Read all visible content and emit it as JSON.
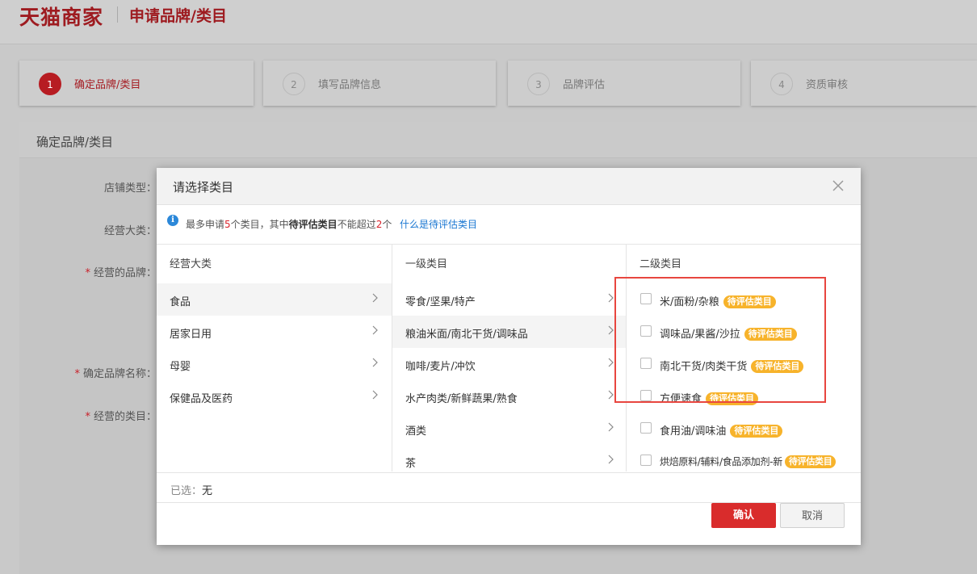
{
  "header": {
    "logo": "天猫商家",
    "title": "申请品牌/类目"
  },
  "steps": [
    {
      "num": "1",
      "label": "确定品牌/类目",
      "active": true
    },
    {
      "num": "2",
      "label": "填写品牌信息",
      "active": false
    },
    {
      "num": "3",
      "label": "品牌评估",
      "active": false
    },
    {
      "num": "4",
      "label": "资质审核",
      "active": false
    }
  ],
  "panel": {
    "title": "确定品牌/类目",
    "fields": {
      "store_type": "店铺类型：",
      "main_category": "经营大类：",
      "brand": "经营的品牌：",
      "brand_name": "确定品牌名称：",
      "category": "经营的类目："
    },
    "required_mark": "*"
  },
  "dialog": {
    "title": "请选择类目",
    "notice": {
      "p1": "最多申请",
      "max": "5",
      "p2": "个类目，其中",
      "bold": "待评估类目",
      "p3": "不能超过",
      "limit": "2",
      "p4": "个",
      "link": "什么是待评估类目"
    },
    "columns": {
      "main": {
        "header": "经营大类",
        "items": [
          "食品",
          "居家日用",
          "母婴",
          "保健品及医药"
        ],
        "selected_index": 0
      },
      "level1": {
        "header": "一级类目",
        "items": [
          "零食/坚果/特产",
          "粮油米面/南北干货/调味品",
          "咖啡/麦片/冲饮",
          "水产肉类/新鲜蔬果/熟食",
          "酒类",
          "茶"
        ],
        "selected_index": 1
      },
      "level2": {
        "header": "二级类目",
        "badge": "待评估类目",
        "items": [
          "米/面粉/杂粮",
          "调味品/果酱/沙拉",
          "南北干货/肉类干货",
          "方便速食",
          "食用油/调味油",
          "烘焙原料/辅料/食品添加剂-新"
        ]
      }
    },
    "selected": {
      "label": "已选：",
      "value": "无"
    },
    "buttons": {
      "confirm": "确认",
      "cancel": "取消"
    }
  },
  "colors": {
    "brand_red": "#9e1b20",
    "primary_button": "#d92c2c",
    "badge": "#f7b32b",
    "link": "#1a77d2",
    "highlight_border": "#e8463f"
  }
}
